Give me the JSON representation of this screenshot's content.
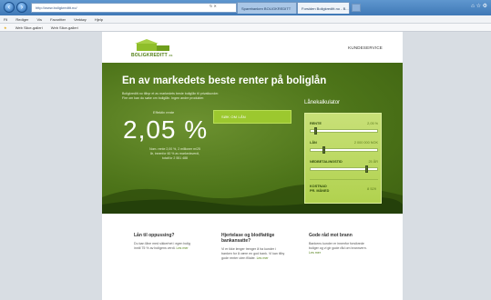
{
  "browser": {
    "address": "http://www.boligkreditt.no/",
    "tabs": [
      {
        "label": "Sparebanken BOLIGKREDITT"
      },
      {
        "label": "Forsiden Boligkreditt.no - B..."
      }
    ],
    "menu": [
      "Fil",
      "Rediger",
      "Vis",
      "Favoritter",
      "Verktøy",
      "Hjelp"
    ],
    "favorites": [
      "Web Slice-galleri",
      "Web Slice-galleri"
    ]
  },
  "header": {
    "logo_text": "BOLIGKREDITT",
    "logo_suffix": "as",
    "kundeservice": "KUNDESERVICE"
  },
  "hero": {
    "title": "En av markedets beste renter på boliglån",
    "description": "Boligkreditt.no tilbyr et av markedets beste boliglån til privatkunder. Fire om kan du søke om boliglån. Ingen andre produkter.",
    "rate_label": "Effektiv rente",
    "rate": "2,05 %",
    "rate_note": "Nom. rente 2,00 %, 2 millioner m/25 år, innenfor 60 % av markedsverdi, totalt kr 2 551 488",
    "cta": "SØK OM LÅN"
  },
  "calculator": {
    "title": "Lånekalkulator",
    "rente_label": "RENTE",
    "rente_value": "2,05 %",
    "rente_level": 0.08,
    "lan_label": "LÅN",
    "lan_value": "2 000 000 NOK",
    "lan_level": 0.2,
    "tid_label": "NEDBETALINGSTID",
    "tid_value": "25 ÅR",
    "tid_level": 0.85,
    "kostnad_label": "KOSTNAD",
    "kostnad_sub": "PR. MÅNED",
    "kostnad_value": "8 529"
  },
  "info": [
    {
      "title": "Lån til oppussing?",
      "text": "Du kan låne med sikkerhet i egen bolig inntil 75 % av boligens verdi.",
      "more": "Les mer"
    },
    {
      "title": "Hjertelase og blodfattige bankansatte?",
      "text": "Vi er ikke lenger trenger å ha kunder i banken for å være en god bank. Vi kan tilby gode renter uten filialer.",
      "more": "Les mer"
    },
    {
      "title": "Gode råd mot brann",
      "text": "Bankens kunder er innenfor forsikrede boliger og vi gir gode råd om brannvern.",
      "more": "Les mer"
    }
  ],
  "colors": {
    "brand_green": "#4f7d14",
    "accent_lime": "#9cc82f",
    "calc_bg": "#b1d24f"
  }
}
